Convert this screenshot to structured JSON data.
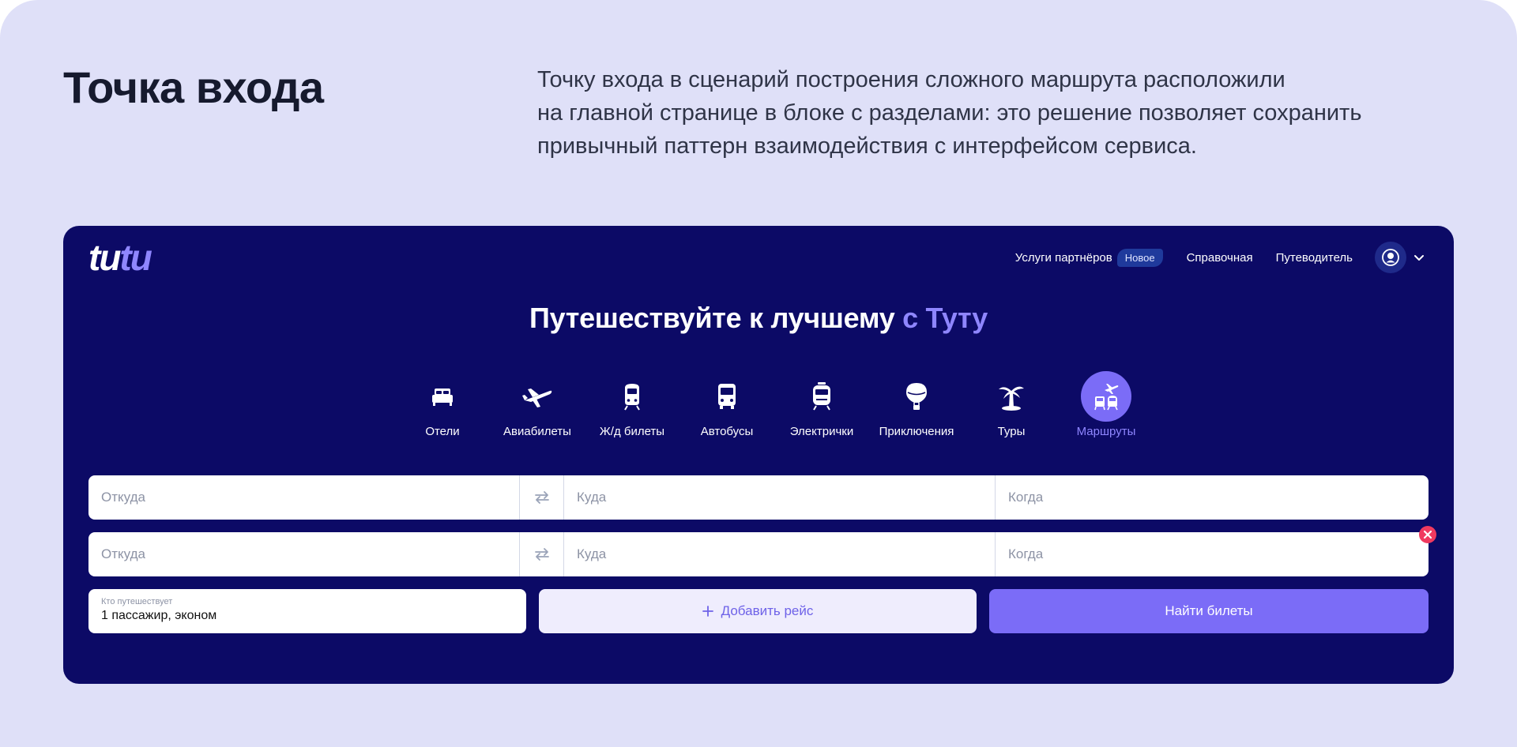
{
  "slide": {
    "title": "Точка входа",
    "description": [
      "Точку входа в сценарий построения сложного маршрута расположили",
      "на главной странице в блоке с разделами: это решение позволяет сохранить",
      "привычный паттерн взаимодействия с интерфейсом сервиса."
    ]
  },
  "header": {
    "logo_part1": "tu",
    "logo_part2": "tu",
    "nav": {
      "partners": "Услуги партнёров",
      "partners_badge": "Новое",
      "help": "Справочная",
      "guide": "Путеводитель"
    }
  },
  "hero": {
    "title": "Путешествуйте к лучшему",
    "accent": "с Туту"
  },
  "categories": [
    {
      "label": "Отели",
      "icon": "bed-icon"
    },
    {
      "label": "Авиабилеты",
      "icon": "plane-icon"
    },
    {
      "label": "Ж/д билеты",
      "icon": "train-icon"
    },
    {
      "label": "Автобусы",
      "icon": "bus-icon"
    },
    {
      "label": "Электрички",
      "icon": "suburban-train-icon"
    },
    {
      "label": "Приключения",
      "icon": "balloon-icon"
    },
    {
      "label": "Туры",
      "icon": "palm-icon"
    },
    {
      "label": "Маршруты",
      "icon": "routes-icon",
      "active": true
    }
  ],
  "routes": [
    {
      "from_placeholder": "Откуда",
      "to_placeholder": "Куда",
      "when_placeholder": "Когда"
    },
    {
      "from_placeholder": "Откуда",
      "to_placeholder": "Куда",
      "when_placeholder": "Когда"
    }
  ],
  "passengers": {
    "label": "Кто путешествует",
    "value": "1 пассажир, эконом"
  },
  "actions": {
    "add_flight": "Добавить рейс",
    "find_tickets": "Найти билеты"
  },
  "colors": {
    "page_bg": "#dfe0f8",
    "app_bg": "#0c0a66",
    "accent": "#7b6cf7",
    "remove": "#f03a5f"
  }
}
